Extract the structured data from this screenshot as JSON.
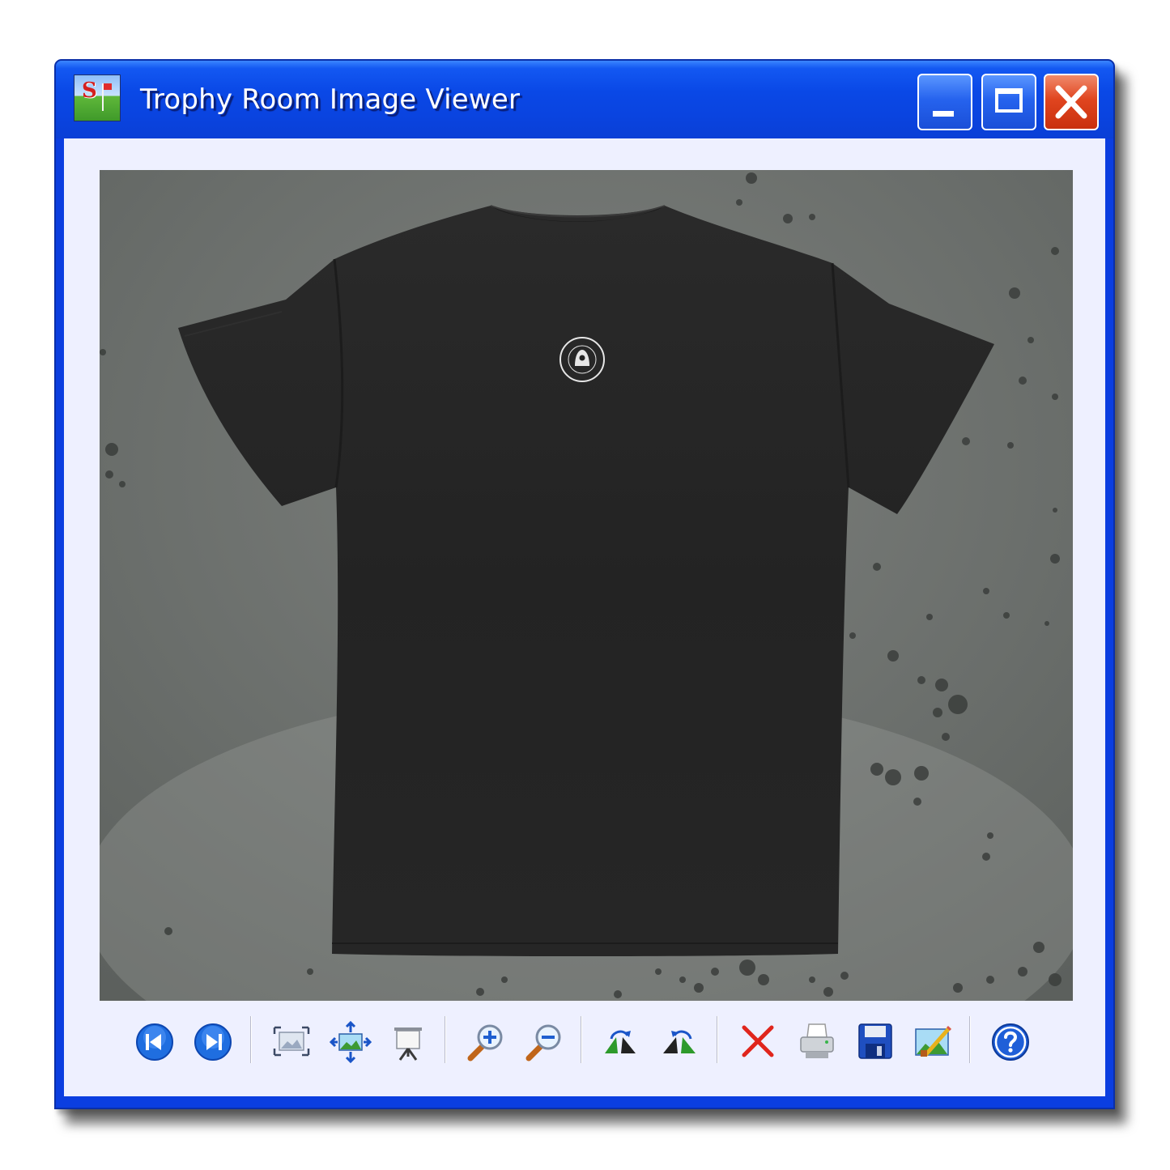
{
  "window": {
    "title": "Trophy Room Image Viewer",
    "app_icon": "golf-flag-monogram-icon",
    "controls": [
      "minimize",
      "maximize",
      "close"
    ]
  },
  "toolbar": {
    "buttons": [
      {
        "id": "previous-image",
        "icon": "previous-icon"
      },
      {
        "id": "next-image",
        "icon": "next-icon"
      },
      {
        "id": "best-fit",
        "icon": "best-fit-icon"
      },
      {
        "id": "actual-size",
        "icon": "actual-size-icon"
      },
      {
        "id": "slideshow",
        "icon": "slideshow-icon"
      },
      {
        "id": "zoom-in",
        "icon": "zoom-in-icon"
      },
      {
        "id": "zoom-out",
        "icon": "zoom-out-icon"
      },
      {
        "id": "rotate-clockwise",
        "icon": "rotate-clockwise-icon"
      },
      {
        "id": "rotate-counterclockwise",
        "icon": "rotate-counterclockwise-icon"
      },
      {
        "id": "delete",
        "icon": "delete-icon"
      },
      {
        "id": "print",
        "icon": "print-icon"
      },
      {
        "id": "save",
        "icon": "floppy-disk-icon"
      },
      {
        "id": "edit",
        "icon": "edit-image-icon"
      },
      {
        "id": "help",
        "icon": "help-icon"
      }
    ]
  },
  "image": {
    "subject": "black-tshirt-back-photo",
    "colors": {
      "shirt": "#262626",
      "background": "#6f7370",
      "badge": "#e6e6e6"
    }
  },
  "colors": {
    "titlebar": "#0a48e6",
    "client": "#eef0ff",
    "close_button": "#e0451f",
    "nav_blue": "#1f6ee0"
  }
}
